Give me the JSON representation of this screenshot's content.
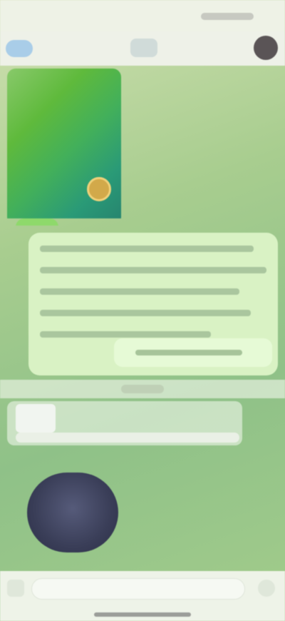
{
  "status_bar": {
    "time": "",
    "icons": "signal-wifi-battery"
  },
  "header": {
    "back_label": "",
    "title": "",
    "avatar": "contact-avatar"
  },
  "messages": {
    "image": {
      "caption": ""
    },
    "text": {
      "lines": [
        "",
        "",
        "",
        "",
        ""
      ],
      "reply": ""
    },
    "date_separator": "",
    "forwarded": {
      "text": ""
    },
    "round_video": {
      "label": ""
    }
  },
  "composer": {
    "placeholder": ""
  },
  "colors": {
    "header_bg": "#eef1e8",
    "bubble_in": "#d9f2c4",
    "accent": "#a9cde8",
    "background": "#a8cd8f"
  }
}
